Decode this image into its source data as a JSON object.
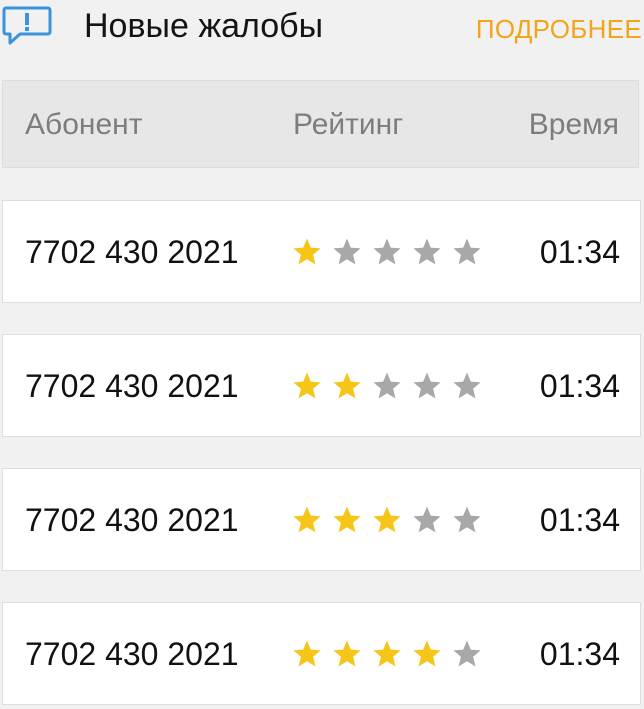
{
  "header": {
    "icon": "chat-alert-icon",
    "title": "Новые жалобы",
    "more_label": "ПОДРОБНЕЕ",
    "accent_color": "#f2a51a"
  },
  "columns": [
    "Абонент",
    "Рейтинг",
    "Время"
  ],
  "rating_max": 5,
  "star_colors": {
    "filled": "#f5c518",
    "empty": "#a8a8a8"
  },
  "rows": [
    {
      "subscriber": "7702 430 2021",
      "rating": 1,
      "time": "01:34"
    },
    {
      "subscriber": "7702 430 2021",
      "rating": 2,
      "time": "01:34"
    },
    {
      "subscriber": "7702 430 2021",
      "rating": 3,
      "time": "01:34"
    },
    {
      "subscriber": "7702 430 2021",
      "rating": 4,
      "time": "01:34"
    }
  ]
}
